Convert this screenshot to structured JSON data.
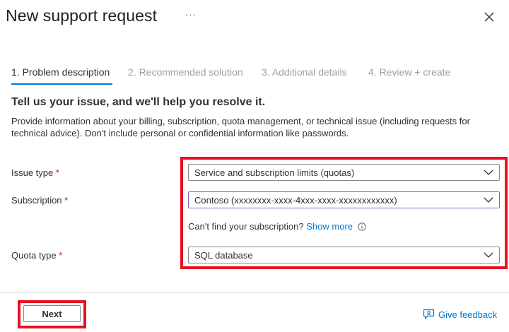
{
  "panel": {
    "title": "New support request",
    "more_label": "···"
  },
  "tabs": [
    {
      "label": "1. Problem description",
      "active": true
    },
    {
      "label": "2. Recommended solution",
      "active": false
    },
    {
      "label": "3. Additional details",
      "active": false
    },
    {
      "label": "4. Review + create",
      "active": false
    }
  ],
  "main": {
    "headline": "Tell us your issue, and we'll help you resolve it.",
    "description": "Provide information about your billing, subscription, quota management, or technical issue (including requests for technical advice). Don't include personal or confidential information like passwords."
  },
  "form": {
    "required_marker": "*",
    "issue_type": {
      "label": "Issue type",
      "value": "Service and subscription limits (quotas)"
    },
    "subscription": {
      "label": "Subscription",
      "value": "Contoso (xxxxxxxx-xxxx-4xxx-xxxx-xxxxxxxxxxxx)"
    },
    "subscription_help": {
      "text": "Can't find your subscription?",
      "link": "Show more"
    },
    "quota_type": {
      "label": "Quota type",
      "value": "SQL database"
    }
  },
  "footer": {
    "next_label": "Next",
    "feedback_label": "Give feedback"
  },
  "colors": {
    "accent": "#0078d4",
    "highlight": "#e81123",
    "required": "#a4262c"
  }
}
